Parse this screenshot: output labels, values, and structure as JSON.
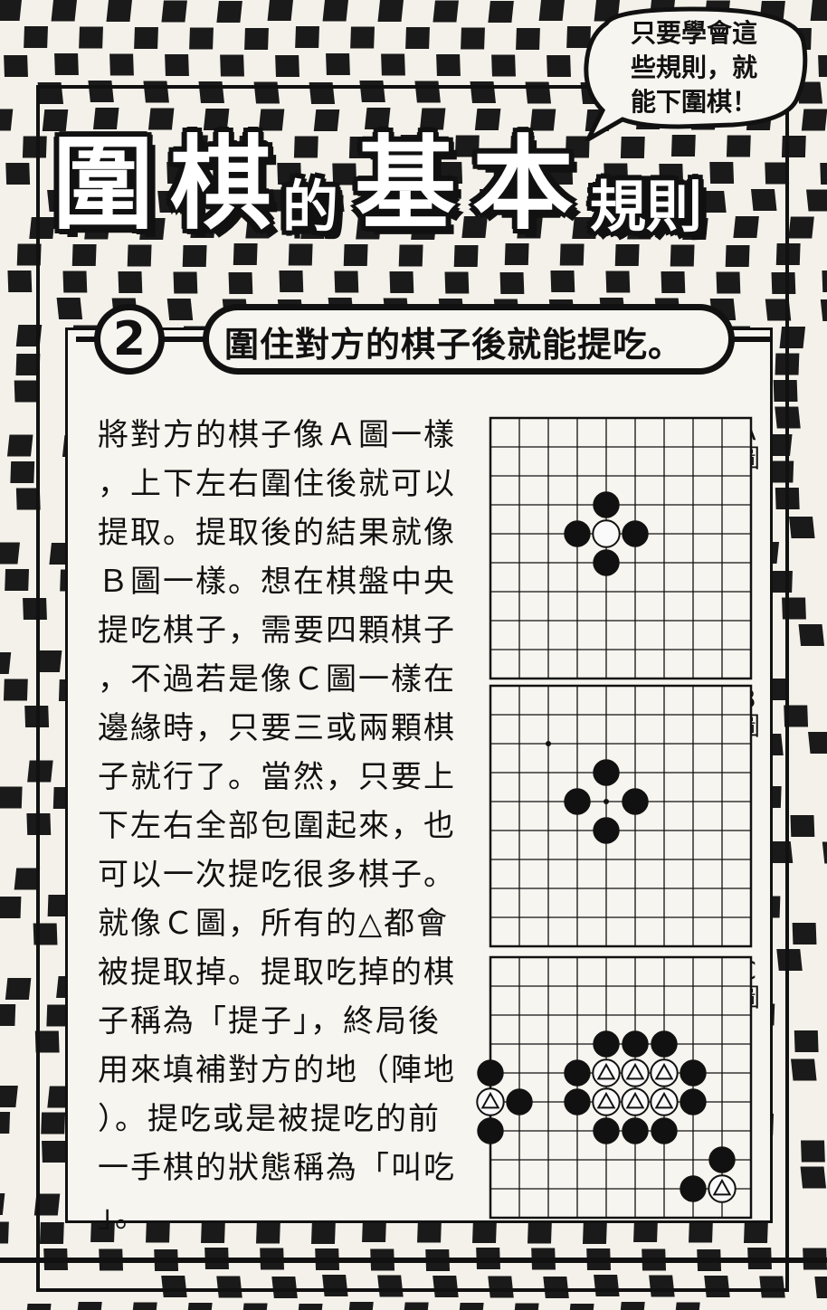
{
  "speech_bubble": {
    "lines": [
      "只要學會這",
      "些規則，就",
      "能下圍棋！"
    ]
  },
  "title": {
    "chars": [
      "圍",
      "棋",
      "的",
      "基",
      "本",
      "規則"
    ]
  },
  "section": {
    "number": "2",
    "heading": "圍住對方的棋子後就能提吃。"
  },
  "body": {
    "lines": [
      "將對方的棋子像Ａ圖一樣",
      "，上下左右圍住後就可以",
      "提取。提取後的結果就像",
      "Ｂ圖一樣。想在棋盤中央",
      "提吃棋子，需要四顆棋子",
      "，不過若是像Ｃ圖一樣在",
      "邊緣時，只要三或兩顆棋",
      "子就行了。當然，只要上",
      "下左右全部包圍起來，也",
      "可以一次提吃很多棋子。",
      "就像Ｃ圖，所有的△都會",
      "被提取掉。提取吃掉的棋",
      "子稱為「提子」，終局後",
      "用來填補對方的地（陣地",
      "）。提吃或是被提吃的前",
      "一手棋的狀態稱為「叫吃",
      "」。"
    ]
  },
  "diagrams": {
    "labels": [
      {
        "letter": "A",
        "suffix": "圖"
      },
      {
        "letter": "B",
        "suffix": "圖"
      },
      {
        "letter": "C",
        "suffix": "圖"
      }
    ],
    "arrow_symbol": "⇩",
    "board_size": 9,
    "boards": [
      {
        "name": "A",
        "stones": [
          {
            "col": 4,
            "row": 3,
            "color": "black"
          },
          {
            "col": 3,
            "row": 4,
            "color": "black"
          },
          {
            "col": 5,
            "row": 4,
            "color": "black"
          },
          {
            "col": 4,
            "row": 5,
            "color": "black"
          },
          {
            "col": 4,
            "row": 4,
            "color": "white"
          }
        ]
      },
      {
        "name": "B",
        "stones": [
          {
            "col": 4,
            "row": 3,
            "color": "black"
          },
          {
            "col": 3,
            "row": 4,
            "color": "black"
          },
          {
            "col": 5,
            "row": 4,
            "color": "black"
          },
          {
            "col": 4,
            "row": 5,
            "color": "black"
          }
        ],
        "dots": [
          {
            "col": 2,
            "row": 2
          },
          {
            "col": 4,
            "row": 4
          }
        ]
      },
      {
        "name": "C",
        "stones": [
          {
            "col": 4,
            "row": 3,
            "color": "black"
          },
          {
            "col": 5,
            "row": 3,
            "color": "black"
          },
          {
            "col": 6,
            "row": 3,
            "color": "black"
          },
          {
            "col": 0,
            "row": 4,
            "color": "black"
          },
          {
            "col": 3,
            "row": 4,
            "color": "black"
          },
          {
            "col": 4,
            "row": 4,
            "color": "white",
            "marked": true
          },
          {
            "col": 5,
            "row": 4,
            "color": "white",
            "marked": true
          },
          {
            "col": 6,
            "row": 4,
            "color": "white",
            "marked": true
          },
          {
            "col": 7,
            "row": 4,
            "color": "black"
          },
          {
            "col": 0,
            "row": 5,
            "color": "white",
            "marked": true
          },
          {
            "col": 1,
            "row": 5,
            "color": "black"
          },
          {
            "col": 3,
            "row": 5,
            "color": "black"
          },
          {
            "col": 4,
            "row": 5,
            "color": "white",
            "marked": true
          },
          {
            "col": 5,
            "row": 5,
            "color": "white",
            "marked": true
          },
          {
            "col": 6,
            "row": 5,
            "color": "white",
            "marked": true
          },
          {
            "col": 7,
            "row": 5,
            "color": "black"
          },
          {
            "col": 0,
            "row": 6,
            "color": "black"
          },
          {
            "col": 4,
            "row": 6,
            "color": "black"
          },
          {
            "col": 5,
            "row": 6,
            "color": "black"
          },
          {
            "col": 6,
            "row": 6,
            "color": "black"
          },
          {
            "col": 8,
            "row": 7,
            "color": "black"
          },
          {
            "col": 7,
            "row": 8,
            "color": "black"
          },
          {
            "col": 8,
            "row": 8,
            "color": "white",
            "marked": true
          }
        ]
      }
    ]
  }
}
